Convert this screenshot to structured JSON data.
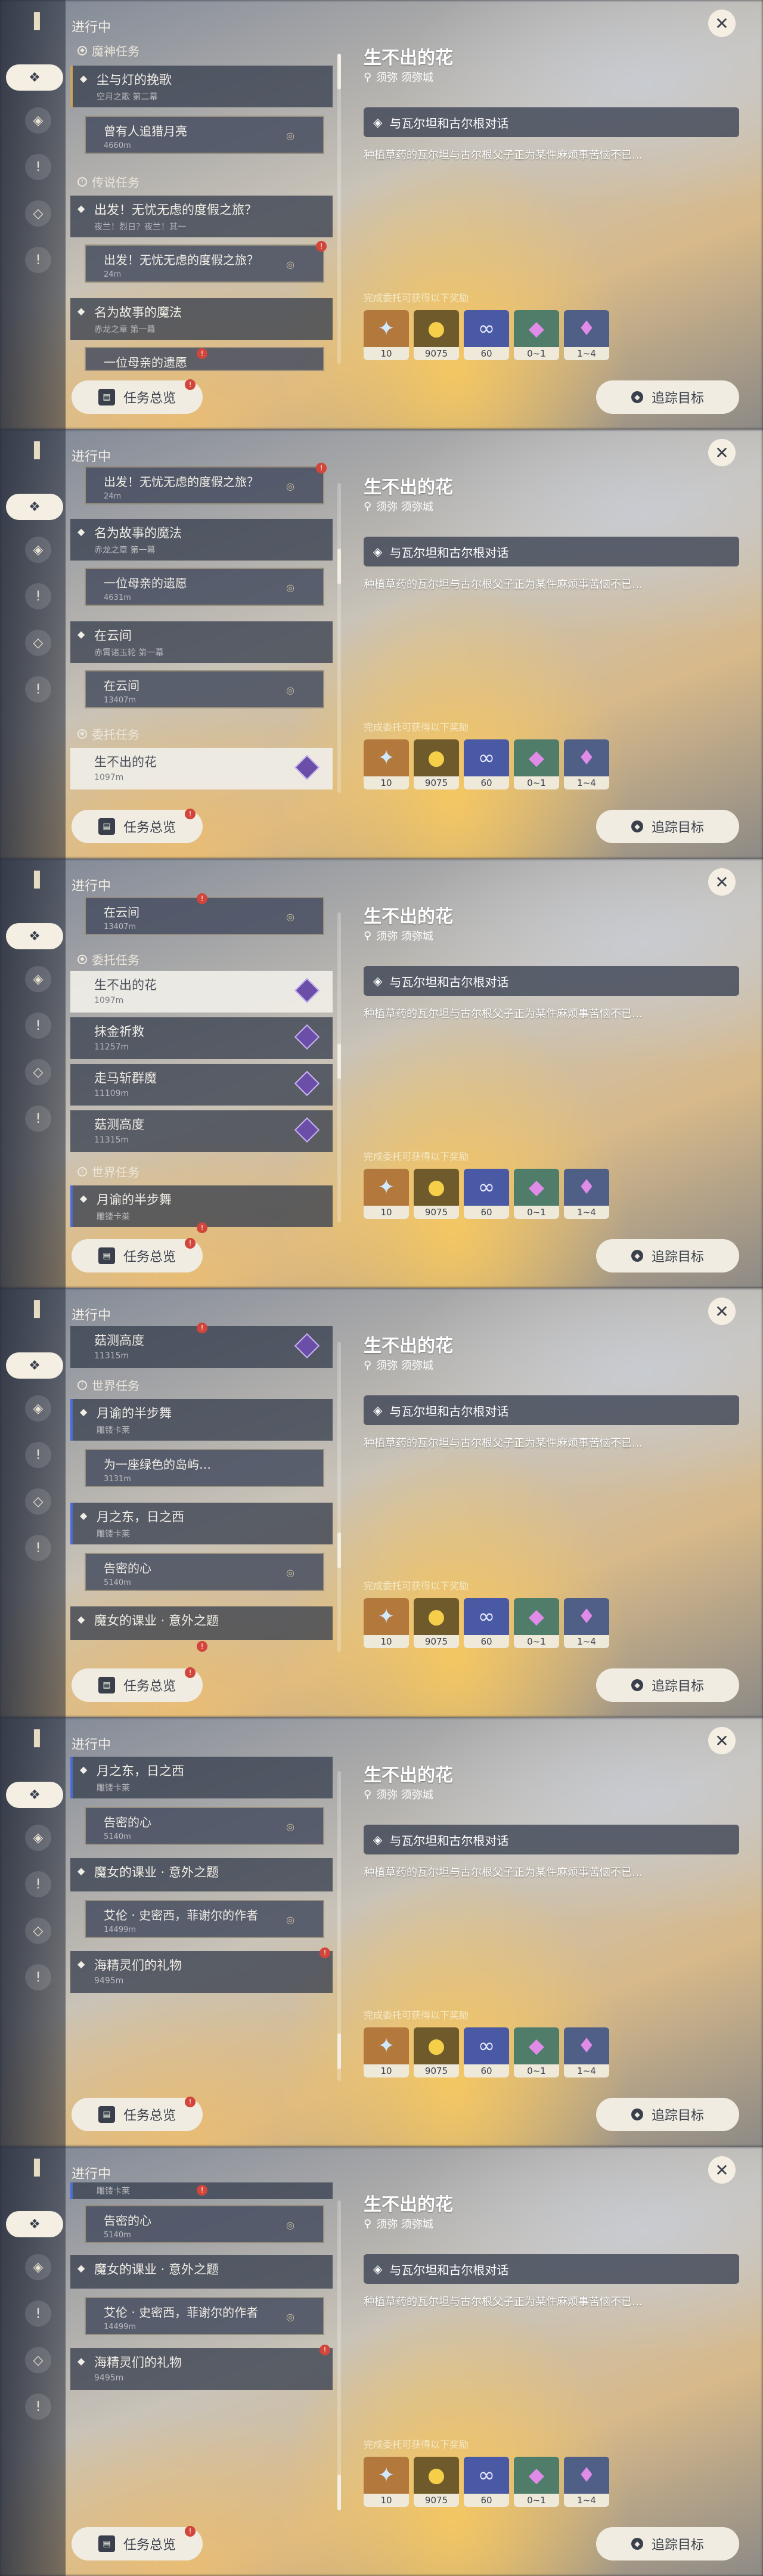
{
  "common": {
    "header": "进行中",
    "quest_title": "生不出的花",
    "location": "须弥 须弥城",
    "objective": "与瓦尔坦和古尔根对话",
    "description": "种植草药的瓦尔坦与古尔根父子正为某件麻烦事苦恼不已…",
    "rewards_label": "完成委托可获得以下奖励",
    "rewards": [
      {
        "icon": "adventure-exp-icon",
        "count": "10"
      },
      {
        "icon": "mora-icon",
        "count": "9075"
      },
      {
        "icon": "companionship-icon",
        "count": "60"
      },
      {
        "icon": "crystal-icon",
        "count": "0~1"
      },
      {
        "icon": "ore-icon",
        "count": "1~4"
      }
    ],
    "quest_overview": "任务总览",
    "track": "追踪目标",
    "colors": {
      "accent": "#f0ece1",
      "alert": "#d2453b",
      "commission": "#6b4ea8",
      "world": "#4b6bd6",
      "archon": "#cda25a"
    }
  },
  "sections": {
    "archon": "魔神任务",
    "legend": "传说任务",
    "commission": "委托任务",
    "world": "世界任务"
  },
  "panel1": {
    "cards": [
      {
        "title": "尘与灯的挽歌",
        "sub": "空月之歌 第二幕"
      },
      {
        "title": "曾有人追猎月亮",
        "sub": "4660m"
      },
      {
        "title": "出发！无忧无虑的度假之旅？",
        "sub": "夜兰！烈日？夜兰！其一"
      },
      {
        "title": "出发！无忧无虑的度假之旅？",
        "sub": "24m"
      },
      {
        "title": "名为故事的魔法",
        "sub": "赤龙之章 第一幕"
      },
      {
        "title": "一位母亲的遗愿",
        "sub": ""
      }
    ]
  },
  "panel2": {
    "cards": [
      {
        "title": "出发！无忧无虑的度假之旅？",
        "sub": "24m"
      },
      {
        "title": "名为故事的魔法",
        "sub": "赤龙之章 第一幕"
      },
      {
        "title": "一位母亲的遗愿",
        "sub": "4631m"
      },
      {
        "title": "在云间",
        "sub": "赤霄诸玉轮 第一幕"
      },
      {
        "title": "在云间",
        "sub": "13407m"
      },
      {
        "title": "生不出的花",
        "sub": "1097m"
      }
    ]
  },
  "panel3": {
    "cards": [
      {
        "title": "在云间",
        "sub": "13407m"
      },
      {
        "title": "生不出的花",
        "sub": "1097m"
      },
      {
        "title": "抹金祈救",
        "sub": "11257m"
      },
      {
        "title": "走马斩群魔",
        "sub": "11109m"
      },
      {
        "title": "菇测高度",
        "sub": "11315m"
      },
      {
        "title": "月谕的半步舞",
        "sub": "雕镂卡莱"
      }
    ]
  },
  "panel4": {
    "cards": [
      {
        "title": "菇测高度",
        "sub": "11315m"
      },
      {
        "title": "月谕的半步舞",
        "sub": "雕镂卡莱"
      },
      {
        "title": "为一座绿色的岛屿…",
        "sub": "3131m"
      },
      {
        "title": "月之东，日之西",
        "sub": "雕镂卡莱"
      },
      {
        "title": "告密的心",
        "sub": "5140m"
      },
      {
        "title": "魔女的课业 · 意外之题",
        "sub": ""
      }
    ]
  },
  "panel5": {
    "cards": [
      {
        "title": "月之东，日之西",
        "sub": "雕镂卡莱"
      },
      {
        "title": "告密的心",
        "sub": "5140m"
      },
      {
        "title": "魔女的课业 · 意外之题",
        "sub": ""
      },
      {
        "title": "艾伦 · 史密西，菲谢尔的作者",
        "sub": "14499m"
      },
      {
        "title": "海精灵们的礼物",
        "sub": "9495m"
      }
    ]
  },
  "panel6": {
    "cards": [
      {
        "title": "雕镂卡莱",
        "sub": ""
      },
      {
        "title": "告密的心",
        "sub": "5140m"
      },
      {
        "title": "魔女的课业 · 意外之题",
        "sub": ""
      },
      {
        "title": "艾伦 · 史密西，菲谢尔的作者",
        "sub": "14499m"
      },
      {
        "title": "海精灵们的礼物",
        "sub": "9495m"
      }
    ]
  }
}
